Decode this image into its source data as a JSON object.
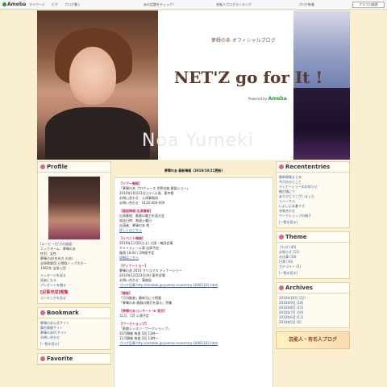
{
  "topbar": {
    "brand": "Ameba",
    "links": [
      "マイページ",
      "ピグ",
      "ブログ書く"
    ],
    "promo_1": "あの話題をチェック！",
    "promo_2": "芸能人ブログランキング",
    "promo_3": "ブログ新着",
    "search_label": "アメブロ検索"
  },
  "header": {
    "subtitle": "夢輝のあ オフィシャルブログ",
    "title": "NET'Z  go for It !",
    "powered_by": "Powered by",
    "powered_brand": "Ameba",
    "name": "Noa Yumeki"
  },
  "profile": {
    "title": "Profile",
    "photo_caption": "[ムービー]ピグの部屋",
    "lines": [
      "ニックネーム：夢輝のあ",
      "性別：女性",
      "夢輝のあ(ゆめき のあ)",
      "宝塚歌劇団 元雪組トップスター",
      "1982年 宝塚入団"
    ],
    "message_link": "メッセージを送る",
    "reader_link": "読者になる",
    "present_link": "プレゼントを贈る",
    "stats_title": "[記事作成]閲覧",
    "stats_link": "ランキングを見る"
  },
  "bookmark": {
    "title": "Bookmark",
    "items": [
      "夢輝のあ公式サイト",
      "舞台情報サイト",
      "夢輝のあFCサイト",
      "お問い合わせ"
    ],
    "more": "[一覧を見る]"
  },
  "favorite": {
    "title": "Favorite"
  },
  "entry": {
    "title": "夢輝のあ 最新情報",
    "date": "(2010/10/21更新)",
    "paras": [
      {
        "head": "【ツアー情報】",
        "lines": [
          "「夢輝のあ プロデュース 世界名曲 歌謡ショー」",
          "2010年10月23日(土)〜公演、東京都",
          "お問い合わせ：公演事務局",
          "お問い合わせ：0120-000-000"
        ]
      },
      {
        "head": "【番組情報/出演情報】",
        "lines": [
          "出演番組：歌劇の魅力を語る会",
          "放送日時：毎週土曜日",
          "出演者：夢輝のあ 他",
          "詳しくはこちら"
        ]
      },
      {
        "head": "【イベント情報】",
        "lines": [
          "2010年11月6日(土) 大阪・梅田会場",
          "チャリティー公演 出演予定",
          "開演 18:00 / 2時間予定",
          "詳細はこちら"
        ]
      },
      {
        "head": "【ディナーショー】",
        "lines": [
          "夢輝のあ 2010 クリスマス ディナーショー",
          "2010年12月23日(木) 東京会場",
          "お問い合わせ：事務局",
          "ブログ記事 http://ameblo.jp/yumeki-noa/entry-10081101.html"
        ]
      },
      {
        "head": "【雑誌】",
        "lines": [
          "「月刊歌劇」最新号にて掲載",
          "「夢輝のあ 歌劇の魅力を語る」特集"
        ]
      },
      {
        "head": "【夢輝のあコンサート in 東京】",
        "lines": [
          "11月、1月 公演予定"
        ]
      },
      {
        "head": "【ワークショップ】",
        "lines": [
          "「歌劇レッスン・ワークショップ」",
          "10月開催 毎週 1回 13時〜",
          "11月開催 毎週 1回 13時〜",
          "ブログ記事 http://ameblo.jp/yumeki-noa/entry-10081102.html"
        ]
      }
    ]
  },
  "recent": {
    "title": "Recententries",
    "items": [
      "最新情報まとめ",
      "今日のひとこと",
      "ディナーショーのお知らせ",
      "稽古場にて",
      "ありがとうございました",
      "リハーサル",
      "いよいよ本番です",
      "衣装合わせ",
      "ワークショップの様子"
    ],
    "more": "[一覧を見る]"
  },
  "theme": {
    "title": "Theme",
    "items": [
      "ブログ (40)",
      "お知らせ (12)",
      "お仕事 (18)",
      "日常 (10)",
      "カテゴリー (5)"
    ],
    "more": "[一覧を見る]"
  },
  "archives": {
    "title": "Archives",
    "items": [
      "2010年10月 (12)",
      "2010年9月 (18)",
      "2010年8月 (15)",
      "2010年7月 (20)",
      "2010年6月 (11)",
      "2010年5月 (9)"
    ]
  },
  "banner": {
    "text": "芸能人・有名人ブログ"
  }
}
